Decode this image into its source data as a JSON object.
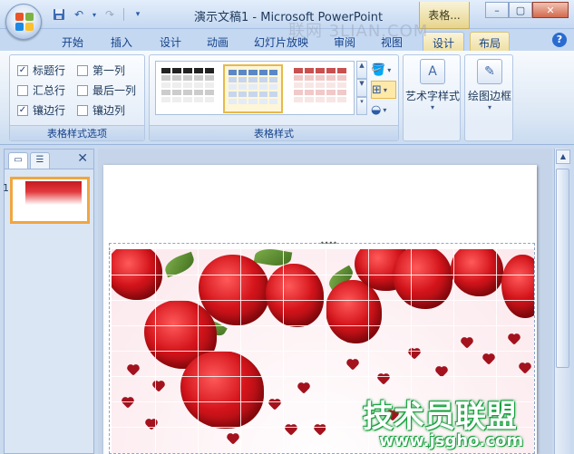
{
  "window": {
    "title": "演示文稿1 - Microsoft PowerPoint",
    "context_tab_title": "表格...",
    "minimize": "–",
    "restore": "▢",
    "close": "✕"
  },
  "qat": {
    "save_icon": "save-icon",
    "undo_icon": "undo-icon",
    "redo_icon": "redo-icon",
    "customize_icon": "customize-icon"
  },
  "tabs": [
    {
      "label": "开始"
    },
    {
      "label": "插入"
    },
    {
      "label": "设计"
    },
    {
      "label": "动画"
    },
    {
      "label": "幻灯片放映"
    },
    {
      "label": "审阅"
    },
    {
      "label": "视图"
    },
    {
      "label": "设计"
    },
    {
      "label": "布局"
    }
  ],
  "ribbon": {
    "options_group": {
      "label": "表格样式选项",
      "checkboxes": [
        {
          "label": "标题行",
          "checked": true
        },
        {
          "label": "第一列",
          "checked": false
        },
        {
          "label": "汇总行",
          "checked": false
        },
        {
          "label": "最后一列",
          "checked": false
        },
        {
          "label": "镶边行",
          "checked": true
        },
        {
          "label": "镶边列",
          "checked": false
        }
      ]
    },
    "styles_group": {
      "label": "表格样式"
    },
    "wordart": {
      "label": "艺术字样式"
    },
    "borders": {
      "label": "绘图边框"
    }
  },
  "panel": {
    "slide_number": "1"
  },
  "watermark": {
    "top": "联网 3LIAN.COM",
    "logo": "技术员联盟",
    "url": "www.jsgho.com"
  },
  "colors": {
    "accent": "#15428b",
    "context_tab": "#e7d48c",
    "selection": "#f0a640"
  }
}
